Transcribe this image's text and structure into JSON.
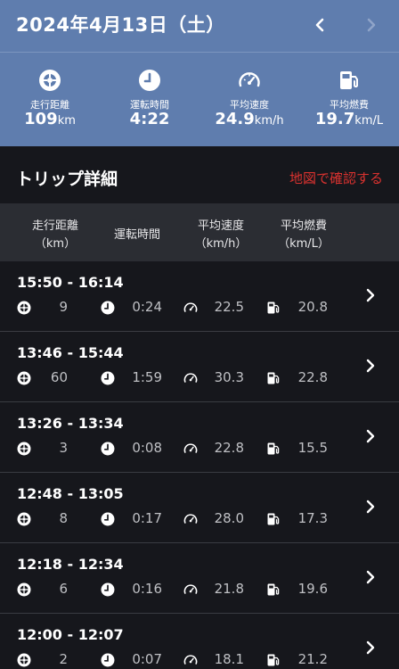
{
  "header": {
    "date": "2024年4月13日（土）",
    "prev_icon": "chevron-left-icon",
    "next_icon": "chevron-right-icon",
    "background": "#5f7dae"
  },
  "summary": {
    "distance": {
      "label": "走行距離",
      "value": "109",
      "unit": "km",
      "icon": "tire-icon"
    },
    "drive_time": {
      "label": "運転時間",
      "value": "4:22",
      "unit": "",
      "icon": "clock-icon"
    },
    "avg_speed": {
      "label": "平均速度",
      "value": "24.9",
      "unit": "km/h",
      "icon": "speedometer-icon"
    },
    "avg_fuel": {
      "label": "平均燃費",
      "value": "19.7",
      "unit": "km/L",
      "icon": "fuel-pump-icon"
    }
  },
  "trip_section": {
    "title": "トリップ詳細",
    "map_link": "地図で確認する",
    "map_link_color": "#d9322f"
  },
  "columns": {
    "distance_l1": "走行距離",
    "distance_l2": "（km）",
    "time": "運転時間",
    "speed_l1": "平均速度",
    "speed_l2": "（km/h）",
    "fuel_l1": "平均燃費",
    "fuel_l2": "（km/L）"
  },
  "trips": [
    {
      "time": "15:50 - 16:14",
      "distance": "9",
      "duration": "0:24",
      "speed": "22.5",
      "fuel": "20.8"
    },
    {
      "time": "13:46 - 15:44",
      "distance": "60",
      "duration": "1:59",
      "speed": "30.3",
      "fuel": "22.8"
    },
    {
      "time": "13:26 - 13:34",
      "distance": "3",
      "duration": "0:08",
      "speed": "22.8",
      "fuel": "15.5"
    },
    {
      "time": "12:48 - 13:05",
      "distance": "8",
      "duration": "0:17",
      "speed": "28.0",
      "fuel": "17.3"
    },
    {
      "time": "12:18 - 12:34",
      "distance": "6",
      "duration": "0:16",
      "speed": "21.8",
      "fuel": "19.6"
    },
    {
      "time": "12:00 - 12:07",
      "distance": "2",
      "duration": "0:07",
      "speed": "18.1",
      "fuel": "21.2"
    }
  ]
}
